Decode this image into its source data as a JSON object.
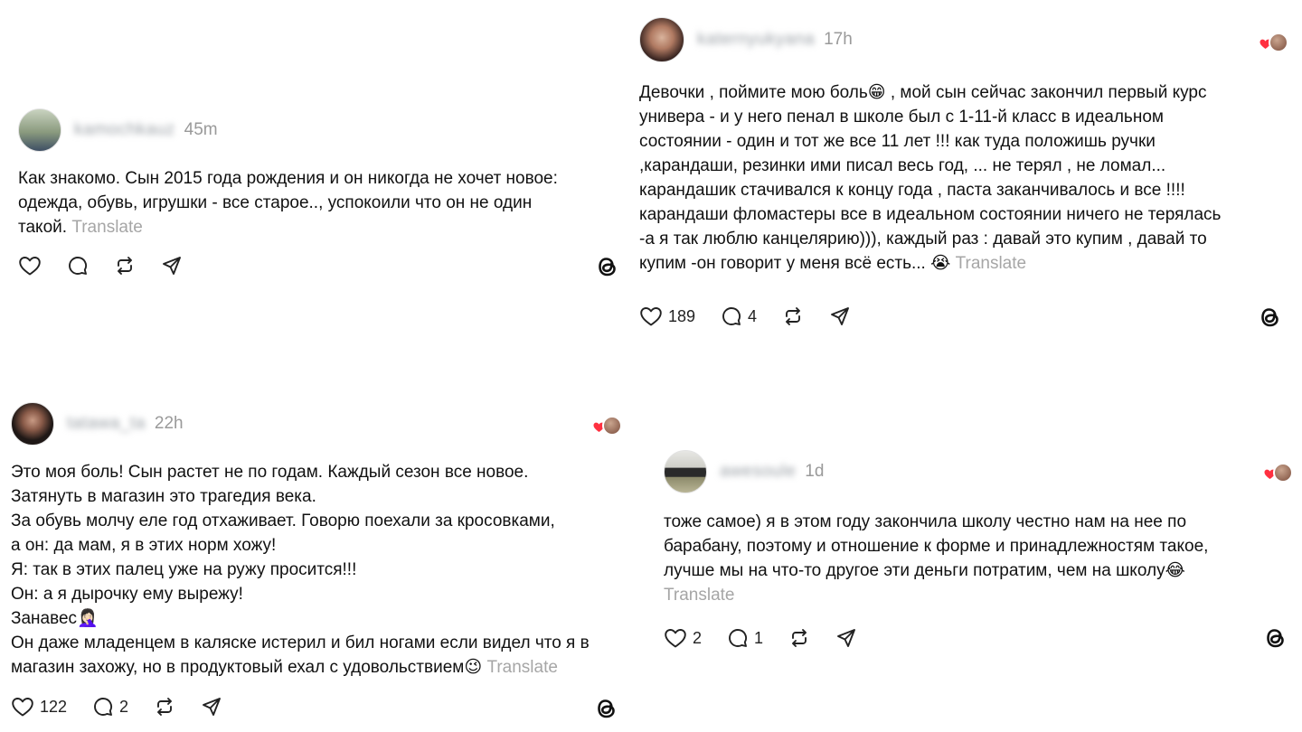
{
  "posts": [
    {
      "username": "kamochkauz",
      "time": "45m",
      "text": "Как знакомо. Сын 2015 года рождения и он никогда не хочет новое:\nодежда, обувь, игрушки - все старое.., успокоили что он не один\nтакой.",
      "translate": "Translate",
      "likes": "",
      "comments": "",
      "avatar_color": "#7f8c7a"
    },
    {
      "username": "katernyukyana",
      "time": "17h",
      "text": "Девочки , поймите мою боль😁 , мой сын сейчас закончил первый курс\nунивера - и у него пенал в школе был с 1-11-й класс в идеальном\nсостоянии - один и тот же все 11 лет !!! как туда положишь ручки\n,карандаши, резинки ими писал весь год, ... не терял , не ломал...\nкарандашик стачивался к концу года , паста заканчивалось и все !!!!\nкарандаши фломастеры все в идеальном состоянии ничего не терялась\n-а я так люблю канцелярию))), каждый раз : давай это купим , давай то\nкупим -он говорит у меня всё есть... 😭",
      "translate": "Translate",
      "likes": "189",
      "comments": "4",
      "avatar_color": "#5a3a30"
    },
    {
      "username": "tatawa_ta",
      "time": "22h",
      "text": "Это моя боль! Сын растет не по годам. Каждый сезон все новое.\nЗатянуть в магазин это трагедия века.\nЗа обувь молчу еле год отхаживает. Говорю поехали за кросовками,\nа он: да мам, я в этих норм хожу!\nЯ: так в этих палец уже на ружу просится!!!\nОн: а я дырочку ему вырежу!\nЗанавес🤦🏻‍♀️\nОн даже младенцем в каляске истерил и бил ногами если видел что я в\nмагазин захожу, но в продуктовый ехал с удовольствием😉",
      "translate": "Translate",
      "likes": "122",
      "comments": "2",
      "avatar_color": "#2b211d"
    },
    {
      "username": "awesoule",
      "time": "1d",
      "text": "тоже самое) я в этом году закончила школу честно нам на нее по\nбарабану, поэтому и отношение к форме и принадлежностям такое,\nлучше мы на что-то другое эти деньги потратим, чем на школу😂",
      "translate": "Translate",
      "likes": "2",
      "comments": "1",
      "avatar_color": "#3a3a3a"
    }
  ],
  "icons": {
    "like": "heart-icon",
    "comment": "comment-icon",
    "repost": "repost-icon",
    "share": "send-icon",
    "brand": "threads-logo-icon",
    "reaction": "liked-by-author-icon"
  },
  "colors": {
    "text": "#111111",
    "muted": "#9a9a9a",
    "heart": "#ff3040"
  }
}
